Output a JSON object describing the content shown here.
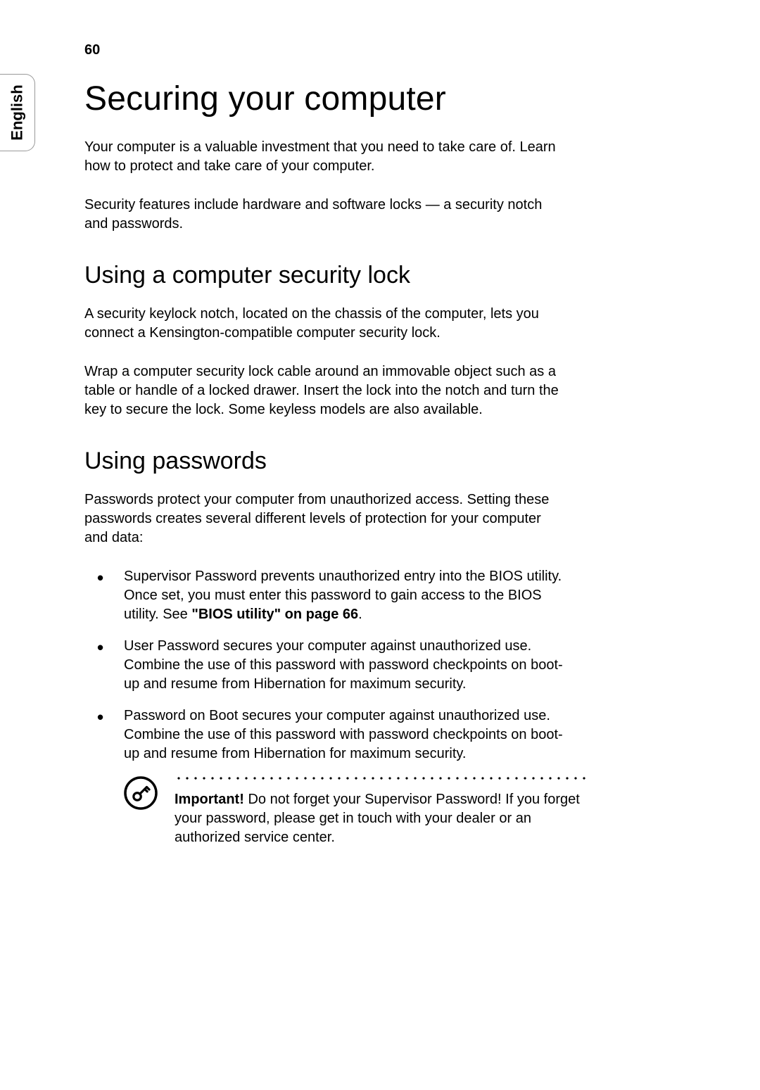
{
  "page_number": "60",
  "side_tab": "English",
  "title": "Securing your computer",
  "intro_paragraphs": [
    "Your computer is a valuable investment that you need to take care of. Learn how to protect and take care of your computer.",
    "Security features include hardware and software locks — a security notch and passwords."
  ],
  "sections": [
    {
      "heading": "Using a computer security lock",
      "paragraphs": [
        "A security keylock notch, located on the chassis of the computer, lets you connect a Kensington-compatible computer security lock.",
        "Wrap a computer security lock cable around an immovable object such as a table or handle of a locked drawer. Insert the lock into the notch and turn the key to secure the lock. Some keyless models are also available."
      ]
    },
    {
      "heading": "Using passwords",
      "paragraphs": [
        "Passwords protect your computer from unauthorized access. Setting these passwords creates several different levels of protection for your computer and data:"
      ],
      "bullets": [
        {
          "text": "Supervisor Password prevents unauthorized entry into the BIOS utility. Once set, you must enter this password to gain access to the BIOS utility. See ",
          "ref": "\"BIOS utility\" on page 66",
          "suffix": "."
        },
        {
          "text": "User Password secures your computer against unauthorized use. Combine the use of this password with password checkpoints on boot-up and resume from Hibernation for maximum security."
        },
        {
          "text": "Password on Boot secures your computer against unauthorized use. Combine the use of this password with password checkpoints on boot-up and resume from Hibernation for maximum security."
        }
      ],
      "note": {
        "lead": "Important!",
        "text": " Do not forget your Supervisor Password! If you forget your password, please get in touch with your dealer or an authorized service center."
      }
    }
  ]
}
